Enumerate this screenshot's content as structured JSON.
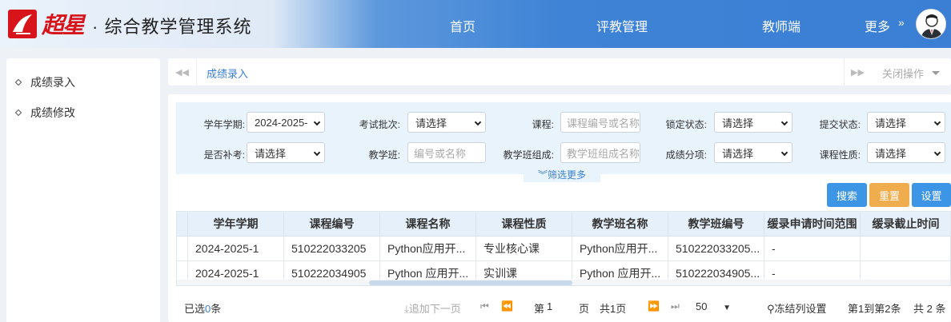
{
  "header": {
    "brand_logo_text": "超星",
    "system_title": "· 综合教学管理系统",
    "nav": [
      "首页",
      "评教管理",
      "教师端",
      "更多"
    ],
    "more_arrow": "»"
  },
  "sidebar": {
    "items": [
      "成绩录入",
      "成绩修改"
    ]
  },
  "tabs": {
    "active": "成绩录入",
    "close_ops": "关闭操作"
  },
  "filters": {
    "term_label": "学年学期:",
    "term_value": "2024-2025-",
    "exam_batch_label": "考试批次:",
    "exam_batch_value": "请选择",
    "course_label": "课程:",
    "course_placeholder": "课程编号或名称",
    "lock_label": "锁定状态:",
    "lock_value": "请选择",
    "submit_label": "提交状态:",
    "submit_value": "请选择",
    "makeup_label": "是否补考:",
    "makeup_value": "请选择",
    "class_label": "教学班:",
    "class_placeholder": "编号或名称",
    "class_comp_label": "教学班组成:",
    "class_comp_placeholder": "教学班组成名称",
    "score_item_label": "成绩分项:",
    "score_item_value": "请选择",
    "course_type_label": "课程性质:",
    "course_type_value": "请选择",
    "more_filter": "筛选更多"
  },
  "buttons": {
    "search": "搜索",
    "reset": "重置",
    "settings": "设置"
  },
  "colors": {
    "search": "#3d95e6",
    "reset": "#f0ad4e",
    "settings": "#3d95e6"
  },
  "table": {
    "columns": [
      "学年学期",
      "课程编号",
      "课程名称",
      "课程性质",
      "教学班名称",
      "教学班编号",
      "缓录申请时间范围",
      "缓录截止时间"
    ],
    "rows": [
      [
        "2024-2025-1",
        "510222033205",
        "Python应用开...",
        "专业核心课",
        "Python应用开...",
        "510222033205...",
        "-",
        ""
      ],
      [
        "2024-2025-1",
        "510222034905",
        "Python 应用开...",
        "实训课",
        "Python 应用开...",
        "510222034905...",
        "-",
        ""
      ]
    ]
  },
  "footer": {
    "selected_prefix": "已选",
    "selected_count": "0",
    "selected_suffix": "条",
    "append_next": "追加下一页",
    "page_prefix": "第",
    "page_num": "1",
    "page_suffix": "页",
    "total_pages": "共1页",
    "page_size": "50",
    "freeze_cols": "冻结列设置",
    "range": "第1到第2条",
    "total": "共 2 条"
  }
}
